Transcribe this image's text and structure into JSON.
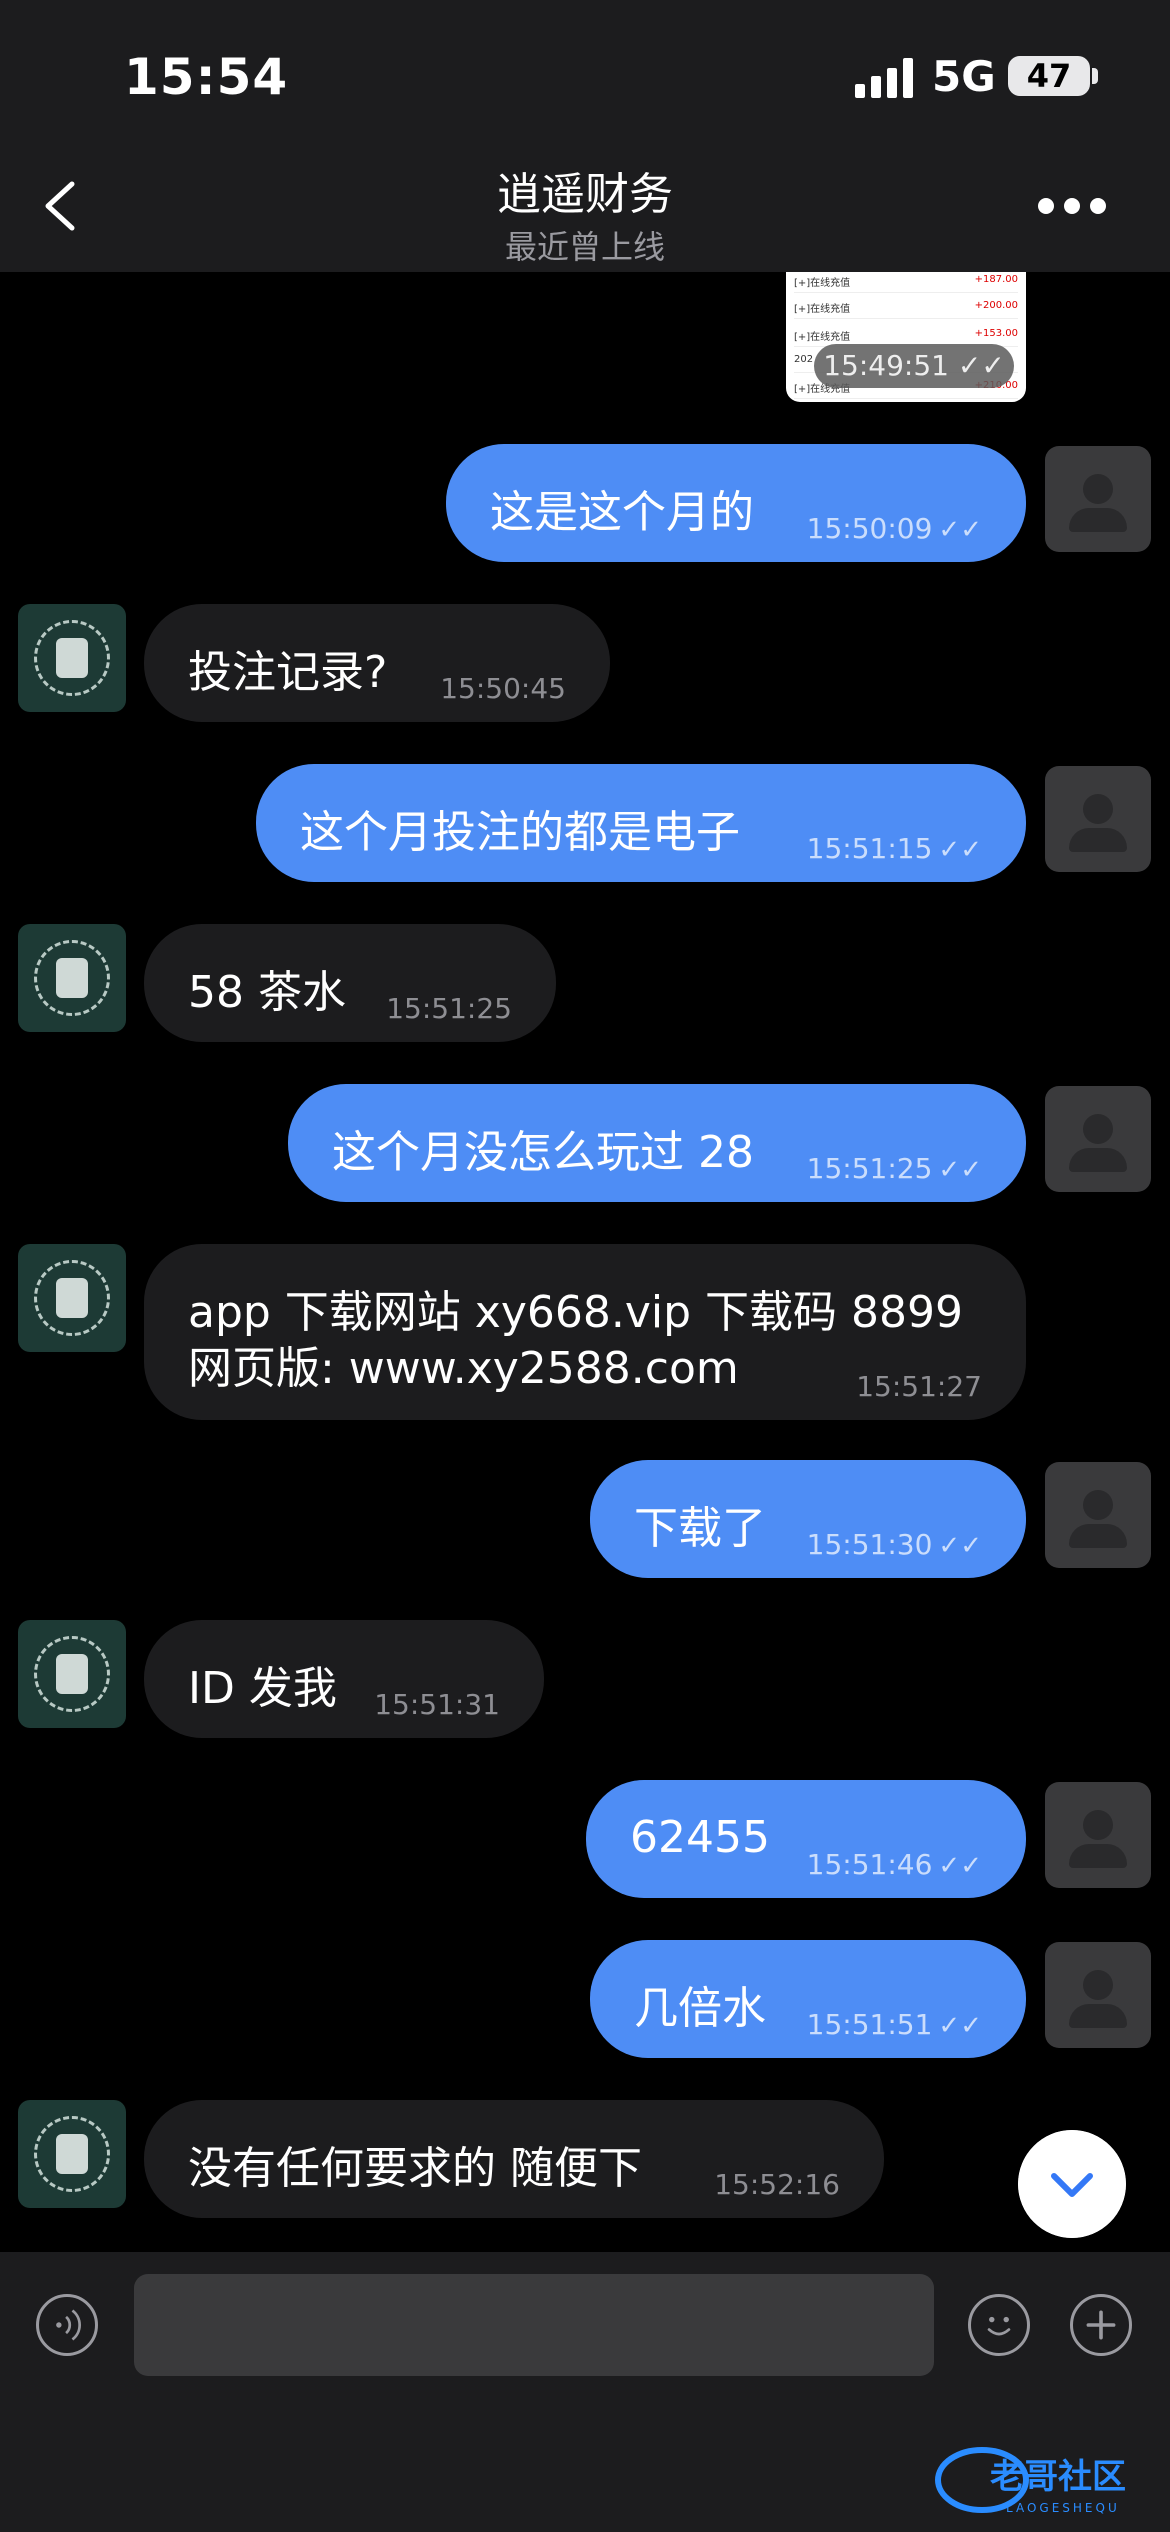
{
  "status_bar": {
    "time": "15:54",
    "network": "5G",
    "battery": "47"
  },
  "header": {
    "title": "逍遥财务",
    "subtitle": "最近曾上线"
  },
  "image_message": {
    "rows": [
      {
        "label": "[+]在线充值",
        "amount": "+187.00"
      },
      {
        "label": "[+]在线充值",
        "amount": "+200.00"
      },
      {
        "label": "[+]在线充值",
        "amount": "+153.00"
      },
      {
        "label": "202",
        "amount": ""
      },
      {
        "label": "[+]在线充值",
        "amount": "+210.00"
      }
    ],
    "time": "15:49:51 ✓✓"
  },
  "messages": [
    {
      "side": "out",
      "text": "这是这个月的",
      "time": "15:50:09"
    },
    {
      "side": "in",
      "text": "投注记录?",
      "time": "15:50:45"
    },
    {
      "side": "out",
      "text": "这个月投注的都是电子",
      "time": "15:51:15"
    },
    {
      "side": "in",
      "text": "58 茶水",
      "time": "15:51:25"
    },
    {
      "side": "out",
      "text": "这个月没怎么玩过 28",
      "time": "15:51:25"
    },
    {
      "side": "in",
      "text": "app 下载网站 xy668.vip 下载码 8899",
      "text2": "网页版: www.xy2588.com",
      "time": "15:51:27"
    },
    {
      "side": "out",
      "text": "下载了",
      "time": "15:51:30"
    },
    {
      "side": "in",
      "text": "ID 发我",
      "time": "15:51:31"
    },
    {
      "side": "out",
      "text": "62455",
      "time": "15:51:46"
    },
    {
      "side": "out",
      "text": "几倍水",
      "time": "15:51:51"
    },
    {
      "side": "in",
      "text": "没有任何要求的 随便下",
      "time": "15:52:16"
    }
  ],
  "ticks": "✓✓",
  "input": {
    "placeholder": ""
  },
  "watermark": {
    "text": "老哥社区",
    "subtext": "LAOGESHEQU"
  }
}
